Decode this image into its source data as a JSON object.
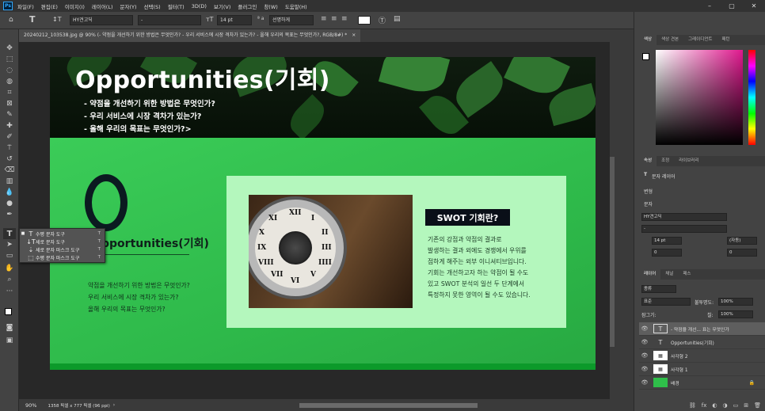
{
  "app": {
    "logo": "Ps"
  },
  "menu": [
    "파일(F)",
    "편집(E)",
    "이미지(I)",
    "레이어(L)",
    "문자(Y)",
    "선택(S)",
    "필터(T)",
    "3D(D)",
    "보기(V)",
    "플러그인",
    "창(W)",
    "도움말(H)"
  ],
  "options": {
    "font_family": "HY견고딕",
    "font_style": "-",
    "font_size": "14 pt",
    "aa_label": "ª a",
    "antialias": "선명하게",
    "share": "공유"
  },
  "tab": {
    "title": "20240212_103538.jpg @ 90% (- 약점을 개선하기 위한 방법은 무엇인가? - 우리 서비스에 시장 격차가 있는가? - 올해 우리의 목표는 무엇인가?, RGB/8#) *",
    "close": "×"
  },
  "status": {
    "zoom": "90%",
    "info": "1358 픽셀 x 777 픽셀 (96 ppi)"
  },
  "flyout": [
    {
      "label": "수평 문자 도구",
      "key": "T",
      "active": true
    },
    {
      "label": "세로 문자 도구",
      "key": "T",
      "active": false
    },
    {
      "label": "세로 문자 마스크 도구",
      "key": "T",
      "active": false
    },
    {
      "label": "수평 문자 마스크 도구",
      "key": "T",
      "active": false
    }
  ],
  "document": {
    "title": "Opportunities(기회)",
    "bullets": [
      "- 약점을 개선하기 위한 방법은 무엇인가?",
      "- 우리 서비스에 시장 격차가 있는가?",
      "- 올해 우리의 목표는 무엇인가?>"
    ],
    "big_letter": "O",
    "subtitle": "pportunities(기회)",
    "questions": [
      "약점을 개선하기 위한 방법은 무엇인가?",
      "우리 서비스에 시장 격차가 있는가?",
      "올해 우리의 목표는 무엇인가?"
    ],
    "box_title": "SWOT 기회란?",
    "paragraph": [
      "기존의 강점과 약점의 결과로",
      "발생하는 결과 외에도 경쟁에서 우위를",
      "점하게 해주는 외부 이니셔티브입니다.",
      "기회는 개선하고자 하는 약점이 될 수도",
      "있고 SWOT 분석의 일선 두 단계에서",
      "특정하지 못한 영역이 될 수도 있습니다."
    ],
    "roman": [
      "XII",
      "I",
      "II",
      "III",
      "IIII",
      "V",
      "VI",
      "VII",
      "VIII",
      "IX",
      "X",
      "XI"
    ]
  },
  "panels": {
    "color_tabs": [
      "색상",
      "색상 견본",
      "그레이디언트",
      "패턴"
    ],
    "prop_tabs": [
      "속성",
      "조정",
      "라이브러리"
    ],
    "text_layer": "문자 레이어",
    "transform": "변형",
    "character": "문자",
    "char_font": "HY견고딕",
    "char_style": "-",
    "char_size": "14 pt",
    "char_leading": "(자동)",
    "char_kern": "0",
    "char_track": "0",
    "layers_tabs": [
      "레이어",
      "채널",
      "패스"
    ],
    "kind": "종류",
    "blend": "표준",
    "opacity_label": "불투명도:",
    "opacity": "100%",
    "lock_label": "잠그기:",
    "fill_label": "칠:",
    "fill": "100%"
  },
  "layers": [
    {
      "name": "- 약점을 개선... 표는 무엇인가",
      "type": "text",
      "selected": true
    },
    {
      "name": "Opportunities(기회)",
      "type": "text",
      "selected": false
    },
    {
      "name": "사각형 2",
      "type": "shape",
      "selected": false
    },
    {
      "name": "사각형 1",
      "type": "shape",
      "selected": false
    },
    {
      "name": "배경",
      "type": "image",
      "selected": false
    }
  ]
}
